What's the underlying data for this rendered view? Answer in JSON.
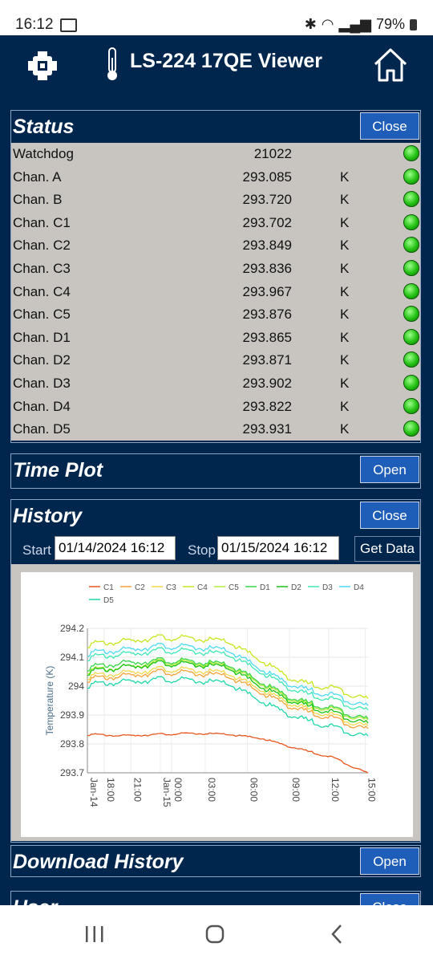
{
  "statusbar": {
    "time": "16:12",
    "battery": "79%"
  },
  "app": {
    "title": "LS-224 17QE Viewer"
  },
  "status": {
    "title": "Status",
    "button": "Close",
    "rows": [
      {
        "label": "Watchdog",
        "value": "21022",
        "unit": ""
      },
      {
        "label": "Chan. A",
        "value": "293.085",
        "unit": "K"
      },
      {
        "label": "Chan. B",
        "value": "293.720",
        "unit": "K"
      },
      {
        "label": "Chan. C1",
        "value": "293.702",
        "unit": "K"
      },
      {
        "label": "Chan. C2",
        "value": "293.849",
        "unit": "K"
      },
      {
        "label": "Chan. C3",
        "value": "293.836",
        "unit": "K"
      },
      {
        "label": "Chan. C4",
        "value": "293.967",
        "unit": "K"
      },
      {
        "label": "Chan. C5",
        "value": "293.876",
        "unit": "K"
      },
      {
        "label": "Chan. D1",
        "value": "293.865",
        "unit": "K"
      },
      {
        "label": "Chan. D2",
        "value": "293.871",
        "unit": "K"
      },
      {
        "label": "Chan. D3",
        "value": "293.902",
        "unit": "K"
      },
      {
        "label": "Chan. D4",
        "value": "293.822",
        "unit": "K"
      },
      {
        "label": "Chan. D5",
        "value": "293.931",
        "unit": "K"
      }
    ]
  },
  "timeplot": {
    "title": "Time Plot",
    "button": "Open"
  },
  "history": {
    "title": "History",
    "button": "Close",
    "start_label": "Start",
    "start_value": "01/14/2024 16:12",
    "stop_label": "Stop",
    "stop_value": "01/15/2024 16:12",
    "get_data": "Get Data"
  },
  "download": {
    "title": "Download History",
    "button": "Open"
  },
  "user": {
    "title": "User",
    "button": "Close"
  },
  "chart_data": {
    "type": "line",
    "title": "",
    "xlabel": "",
    "ylabel": "Temperature (K)",
    "ylim": [
      293.7,
      294.2
    ],
    "yticks": [
      "293.7",
      "293.8",
      "293.9",
      "294",
      "294.1",
      "294.2"
    ],
    "xticks": [
      "Jan-14",
      "18:00",
      "21:00",
      "Jan-15",
      "00:00",
      "03:00",
      "06:00",
      "09:00",
      "12:00",
      "15:00"
    ],
    "x": [
      "Jan-14 16:12",
      "Jan-14 18:00",
      "Jan-14 21:00",
      "Jan-15 00:00",
      "Jan-15 03:00",
      "Jan-15 06:00",
      "Jan-15 09:00",
      "Jan-15 12:00",
      "Jan-15 16:12"
    ],
    "grid": true,
    "legend_position": "top",
    "series": [
      {
        "name": "C1",
        "color": "#e8561c",
        "values": [
          293.835,
          293.83,
          293.835,
          293.838,
          293.835,
          293.82,
          293.785,
          293.755,
          293.7
        ]
      },
      {
        "name": "C2",
        "color": "#f4a33a",
        "values": [
          294.03,
          294.04,
          294.055,
          294.05,
          294.04,
          293.98,
          293.925,
          293.895,
          293.855
        ]
      },
      {
        "name": "C3",
        "color": "#f0d84a",
        "values": [
          294.04,
          294.05,
          294.065,
          294.06,
          294.05,
          293.99,
          293.935,
          293.905,
          293.865
        ]
      },
      {
        "name": "C4",
        "color": "#c8e61e",
        "values": [
          294.15,
          294.16,
          294.175,
          294.17,
          294.16,
          294.09,
          294.02,
          294.0,
          293.96
        ]
      },
      {
        "name": "C5",
        "color": "#b4ea3c",
        "values": [
          294.06,
          294.07,
          294.09,
          294.085,
          294.075,
          294.01,
          293.95,
          293.925,
          293.885
        ]
      },
      {
        "name": "D1",
        "color": "#39d64a",
        "values": [
          294.07,
          294.085,
          294.095,
          294.09,
          294.08,
          294.015,
          293.955,
          293.93,
          293.89
        ]
      },
      {
        "name": "D2",
        "color": "#19c416",
        "values": [
          294.055,
          294.07,
          294.085,
          294.08,
          294.07,
          294.0,
          293.945,
          293.915,
          293.875
        ]
      },
      {
        "name": "D3",
        "color": "#3ee7b3",
        "values": [
          294.105,
          294.115,
          294.13,
          294.125,
          294.115,
          294.05,
          293.985,
          293.96,
          293.92
        ]
      },
      {
        "name": "D4",
        "color": "#4ed9f2",
        "values": [
          294.12,
          294.13,
          294.145,
          294.14,
          294.13,
          294.06,
          294.0,
          293.975,
          293.935
        ]
      },
      {
        "name": "D5",
        "color": "#1fd7a8",
        "values": [
          294.01,
          294.02,
          294.03,
          294.025,
          294.015,
          293.95,
          293.895,
          293.865,
          293.83
        ]
      }
    ]
  }
}
